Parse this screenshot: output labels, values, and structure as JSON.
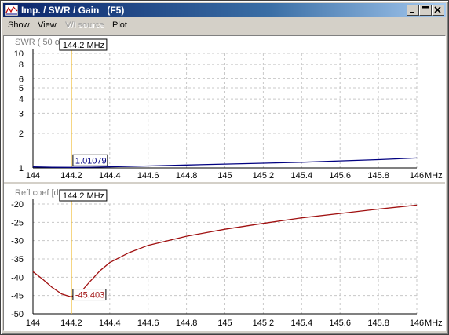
{
  "window": {
    "title": "Imp. / SWR / Gain   (F5)",
    "icon": "chart-window-icon",
    "controls": [
      "minimize-icon",
      "maximize-icon",
      "close-icon"
    ]
  },
  "menu": [
    {
      "label": "Show",
      "enabled": true
    },
    {
      "label": "View",
      "enabled": true
    },
    {
      "label": "V/I source",
      "enabled": false
    },
    {
      "label": "Plot",
      "enabled": true
    }
  ],
  "colors": {
    "swr_trace": "#000080",
    "refl_trace": "#a01010",
    "marker_line": "#f0c040",
    "grid": "#c8c8c8"
  },
  "chart_data": [
    {
      "type": "line",
      "ylabel": "SWR ( 50 o",
      "xlabel": "MHz",
      "x_ticks": [
        "144",
        "144.2",
        "144.4",
        "144.6",
        "144.8",
        "145",
        "145.2",
        "145.4",
        "145.6",
        "145.8",
        "146"
      ],
      "y_ticks": [
        "10",
        "8",
        "6",
        "5",
        "4",
        "3",
        "2",
        "1"
      ],
      "y_scale": "log",
      "xlim": [
        144,
        146
      ],
      "ylim": [
        1,
        10
      ],
      "grid": true,
      "marker": {
        "x_label": "144.2 MHz",
        "x": 144.2,
        "value_label": "1.01079"
      },
      "series": [
        {
          "x": [
            144,
            144.1,
            144.2,
            144.3,
            144.4,
            144.6,
            144.8,
            145,
            145.2,
            145.4,
            145.6,
            145.8,
            146
          ],
          "y": [
            1.02,
            1.013,
            1.011,
            1.014,
            1.022,
            1.04,
            1.06,
            1.08,
            1.1,
            1.12,
            1.15,
            1.18,
            1.22
          ]
        }
      ]
    },
    {
      "type": "line",
      "ylabel": "Refl coef [dB",
      "xlabel": "MHz",
      "x_ticks": [
        "144",
        "144.2",
        "144.4",
        "144.6",
        "144.8",
        "145",
        "145.2",
        "145.4",
        "145.6",
        "145.8",
        "146"
      ],
      "y_ticks": [
        "-20",
        "-25",
        "-30",
        "-35",
        "-40",
        "-45",
        "-50"
      ],
      "xlim": [
        144,
        146
      ],
      "ylim": [
        -50,
        -20
      ],
      "grid": true,
      "marker": {
        "x_label": "144.2 MHz",
        "x": 144.2,
        "value_label": "-45.403"
      },
      "series": [
        {
          "x": [
            144,
            144.05,
            144.1,
            144.15,
            144.2,
            144.25,
            144.3,
            144.35,
            144.4,
            144.5,
            144.6,
            144.8,
            145,
            145.2,
            145.4,
            145.6,
            145.8,
            146
          ],
          "y": [
            -38.5,
            -40.5,
            -42.8,
            -44.6,
            -45.4,
            -44.0,
            -41.0,
            -38.2,
            -36.0,
            -33.3,
            -31.3,
            -28.8,
            -26.9,
            -25.3,
            -23.8,
            -22.6,
            -21.4,
            -20.3
          ]
        }
      ]
    }
  ]
}
